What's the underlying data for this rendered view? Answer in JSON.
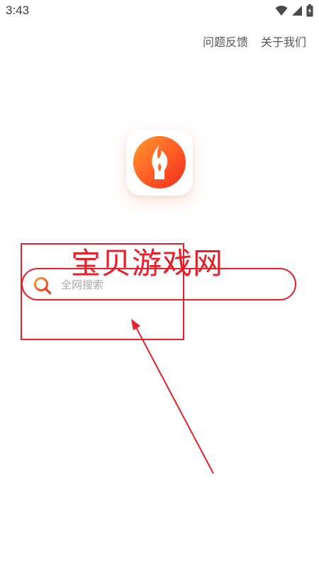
{
  "status_bar": {
    "time": "3:43",
    "icons": [
      "wifi-icon",
      "signal-icon",
      "battery-icon"
    ]
  },
  "header": {
    "links": [
      {
        "label": "问题反馈"
      },
      {
        "label": "关于我们"
      }
    ]
  },
  "logo": {
    "icon": "flame-icon"
  },
  "search": {
    "placeholder": "全网搜索",
    "value": "",
    "icon": "search-icon"
  },
  "annotation": {
    "watermark_text": "宝贝游戏网"
  },
  "colors": {
    "accent": "#ff6a2b",
    "annotation": "#e8202a"
  }
}
